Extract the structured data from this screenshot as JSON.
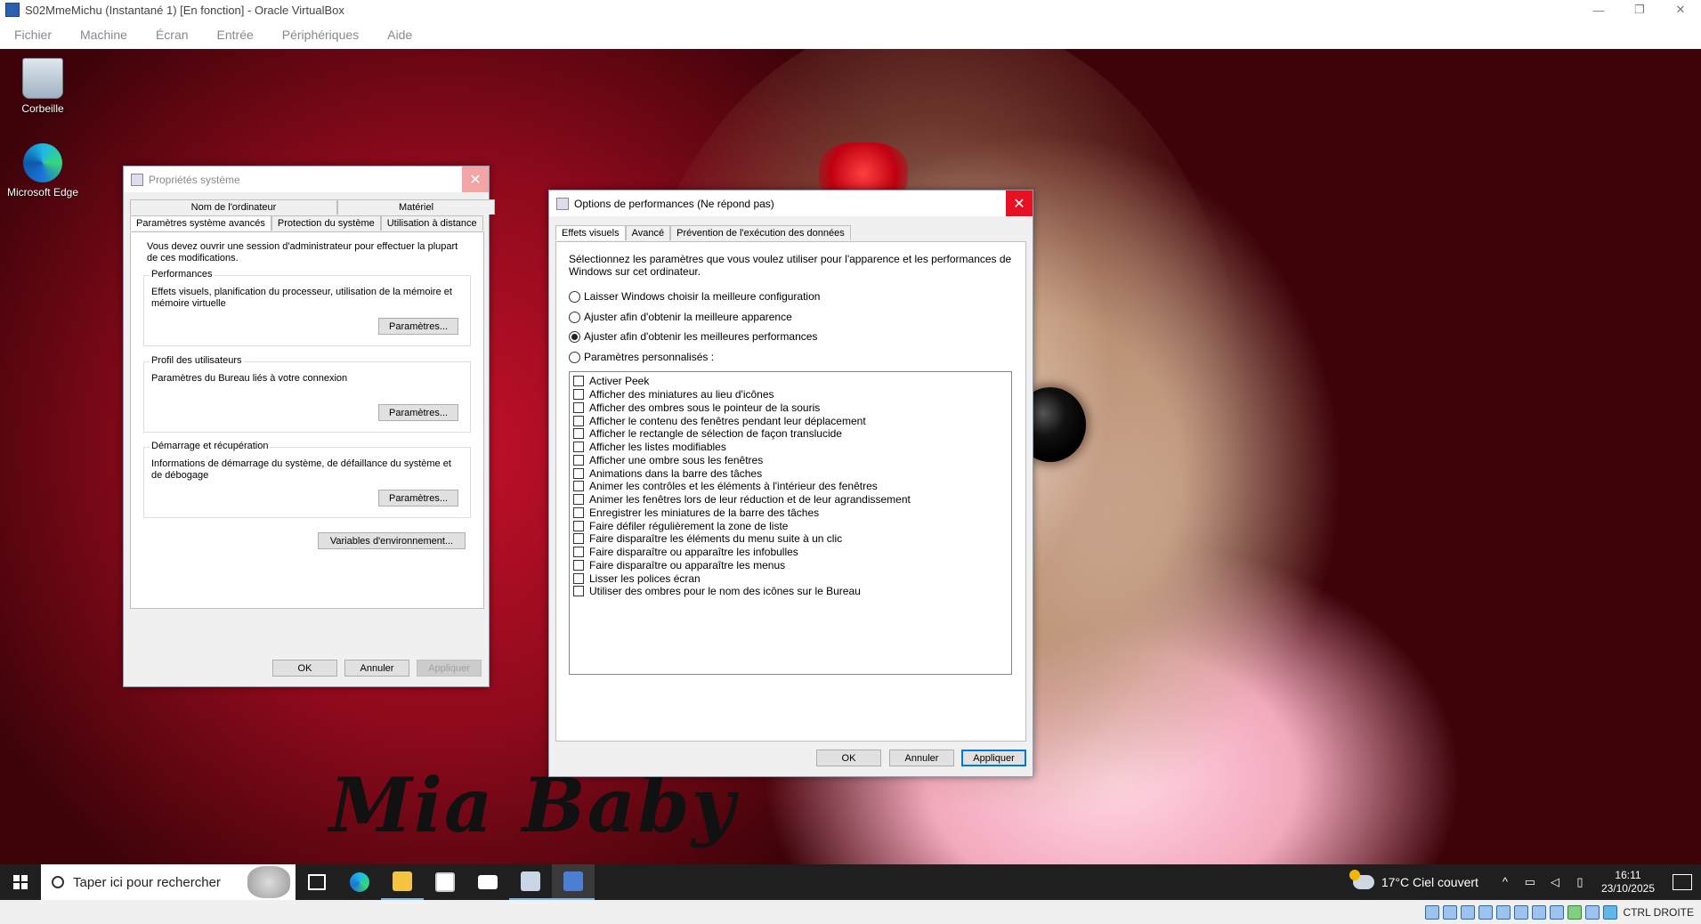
{
  "host_window": {
    "title": "S02MmeMichu (Instantané 1) [En fonction] - Oracle VirtualBox",
    "controls": [
      "—",
      "❐",
      "✕"
    ],
    "menu": [
      "Fichier",
      "Machine",
      "Écran",
      "Entrée",
      "Périphériques",
      "Aide"
    ]
  },
  "desktop": {
    "icons": [
      {
        "label": "Corbeille",
        "icon": "recycle-bin-icon"
      },
      {
        "label": "Microsoft Edge",
        "icon": "edge-icon"
      }
    ],
    "wallpaper_text": "Mia Baby"
  },
  "system_properties": {
    "title": "Propriétés système",
    "close": "✕",
    "tabs_row1": [
      "Nom de l'ordinateur",
      "Matériel"
    ],
    "tabs_row2": [
      "Paramètres système avancés",
      "Protection du système",
      "Utilisation à distance"
    ],
    "admin_note": "Vous devez ouvrir une session d'administrateur pour effectuer la plupart de ces modifications.",
    "groups": [
      {
        "label": "Performances",
        "text": "Effets visuels, planification du processeur, utilisation de la mémoire et mémoire virtuelle",
        "button": "Paramètres..."
      },
      {
        "label": "Profil des utilisateurs",
        "text": "Paramètres du Bureau liés à votre connexion",
        "button": "Paramètres..."
      },
      {
        "label": "Démarrage et récupération",
        "text": "Informations de démarrage du système, de défaillance du système et de débogage",
        "button": "Paramètres..."
      }
    ],
    "env_button": "Variables d'environnement...",
    "ok": "OK",
    "cancel": "Annuler",
    "apply": "Appliquer"
  },
  "performance_options": {
    "title": "Options de performances (Ne répond pas)",
    "close": "✕",
    "tabs": [
      "Effets visuels",
      "Avancé",
      "Prévention de l'exécution des données"
    ],
    "description": "Sélectionnez les paramètres que vous voulez utiliser pour l'apparence et les performances de Windows sur cet ordinateur.",
    "radios": [
      {
        "label": "Laisser Windows choisir la meilleure configuration",
        "checked": false
      },
      {
        "label": "Ajuster afin d'obtenir la meilleure apparence",
        "checked": false
      },
      {
        "label": "Ajuster afin d'obtenir les meilleures performances",
        "checked": true
      },
      {
        "label": "Paramètres personnalisés :",
        "checked": false
      }
    ],
    "effects": [
      "Activer Peek",
      "Afficher des miniatures au lieu d'icônes",
      "Afficher des ombres sous le pointeur de la souris",
      "Afficher le contenu des fenêtres pendant leur déplacement",
      "Afficher le rectangle de sélection de façon translucide",
      "Afficher les listes modifiables",
      "Afficher une ombre sous les fenêtres",
      "Animations dans la barre des tâches",
      "Animer les contrôles et les éléments à l'intérieur des fenêtres",
      "Animer les fenêtres lors de leur réduction et de leur agrandissement",
      "Enregistrer les miniatures de la barre des tâches",
      "Faire défiler régulièrement la zone de liste",
      "Faire disparaître les éléments du menu suite à un clic",
      "Faire disparaître ou apparaître les infobulles",
      "Faire disparaître ou apparaître les menus",
      "Lisser les polices écran",
      "Utiliser des ombres pour le nom des icônes sur le Bureau"
    ],
    "ok": "OK",
    "cancel": "Annuler",
    "apply": "Appliquer"
  },
  "taskbar": {
    "search_placeholder": "Taper ici pour rechercher",
    "apps": [
      "task-view-icon",
      "edge-icon",
      "file-explorer-icon",
      "store-icon",
      "mail-icon",
      "system-properties-icon",
      "performance-options-icon"
    ],
    "weather": "17°C  Ciel couvert",
    "time": "16:11",
    "date": "23/10/2025"
  },
  "vbox_status": {
    "host_key": "CTRL DROITE"
  },
  "colors": {
    "close_active": "#e81123",
    "close_inactive": "#f3a4a4",
    "taskbar": "#1f1f1f",
    "accent": "#0078d7"
  }
}
